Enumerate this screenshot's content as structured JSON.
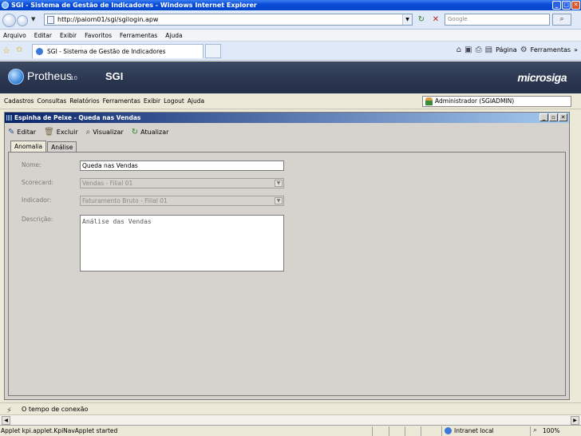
{
  "window": {
    "title": "SGI - Sistema de Gestão de Indicadores - Windows Internet Explorer"
  },
  "browser": {
    "address": "http://paiom01/sgi/sgilogin.apw",
    "search_placeholder": "Google",
    "menu": [
      "Arquivo",
      "Editar",
      "Exibir",
      "Favoritos",
      "Ferramentas",
      "Ajuda"
    ],
    "tab_title": "SGI - Sistema de Gestão de Indicadores",
    "commands": {
      "page": "Página",
      "tools": "Ferramentas",
      "more": "»"
    }
  },
  "app": {
    "brand": "Protheus",
    "brand_version": "10",
    "module": "SGI",
    "vendor": "microsiga",
    "menu": [
      "Cadastros",
      "Consultas",
      "Relatórios",
      "Ferramentas",
      "Exibir",
      "Logout",
      "Ajuda"
    ],
    "user": "Administrador (SGIADMIN)"
  },
  "frame": {
    "title": "Espinha de Peixe - Queda nas Vendas",
    "toolbar": {
      "edit": "Editar",
      "delete": "Excluir",
      "view": "Visualizar",
      "update": "Atualizar"
    },
    "tabs": [
      "Anomalia",
      "Análise"
    ],
    "form": {
      "name_label": "Nome:",
      "name_value": "Queda nas Vendas",
      "scorecard_label": "Scorecard:",
      "scorecard_value": "Vendas - Filial 01",
      "indicator_label": "Indicador:",
      "indicator_value": "Faturamento Bruto - Filial 01",
      "description_label": "Descrição:",
      "description_value": "Análise das Vendas"
    }
  },
  "status": {
    "connection_text": "O tempo de conexão",
    "applet_text": "Applet kpi.applet.KpiNavApplet started",
    "zone": "Intranet local",
    "zoom": "100%"
  }
}
